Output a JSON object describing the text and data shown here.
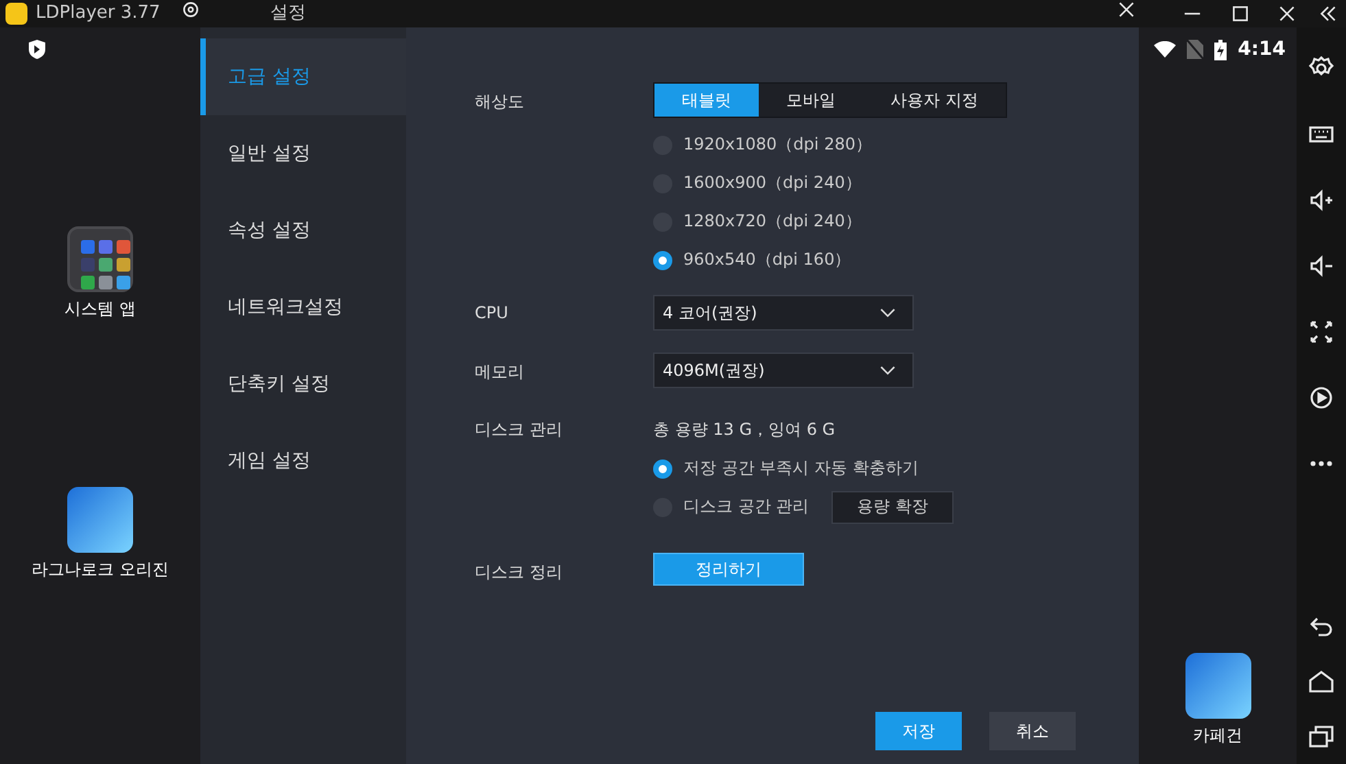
{
  "title_bar": {
    "app_title": "LDPlayer 3.77",
    "dialog_title": "설정"
  },
  "status_bar": {
    "time": "4:14"
  },
  "desktop": {
    "left_apps": [
      {
        "label": "시스템 앱",
        "kind": "folder"
      },
      {
        "label": "라그나로크 오리진",
        "kind": "game"
      }
    ],
    "right_apps": [
      {
        "label": "카페건",
        "kind": "game"
      }
    ]
  },
  "nav": [
    {
      "label": "고급 설정",
      "selected": true
    },
    {
      "label": "일반 설정",
      "selected": false
    },
    {
      "label": "속성 설정",
      "selected": false
    },
    {
      "label": "네트워크설정",
      "selected": false
    },
    {
      "label": "단축키 설정",
      "selected": false
    },
    {
      "label": "게임 설정",
      "selected": false
    }
  ],
  "resolution": {
    "label": "해상도",
    "tabs": [
      {
        "label": "태블릿",
        "selected": true
      },
      {
        "label": "모바일",
        "selected": false
      },
      {
        "label": "사용자 지정",
        "selected": false
      }
    ],
    "options": [
      {
        "label": "1920x1080（dpi 280）",
        "selected": false
      },
      {
        "label": "1600x900（dpi 240）",
        "selected": false
      },
      {
        "label": "1280x720（dpi 240）",
        "selected": false
      },
      {
        "label": "960x540（dpi 160）",
        "selected": true
      }
    ]
  },
  "cpu": {
    "label": "CPU",
    "value": "4 코어(권장)"
  },
  "memory": {
    "label": "메모리",
    "value": "4096M(권장)"
  },
  "disk": {
    "label": "디스크 관리",
    "summary": "총 용량 13 G，잉여 6 G",
    "options": [
      {
        "label": "저장 공간 부족시 자동 확충하기",
        "selected": true
      },
      {
        "label": "디스크 공간 관리",
        "selected": false
      }
    ],
    "expand_button": "용량 확장"
  },
  "cleanup": {
    "label": "디스크 정리",
    "button": "정리하기"
  },
  "buttons": [
    {
      "label": "저장",
      "kind": "primary"
    },
    {
      "label": "취소",
      "kind": "secondary"
    }
  ]
}
